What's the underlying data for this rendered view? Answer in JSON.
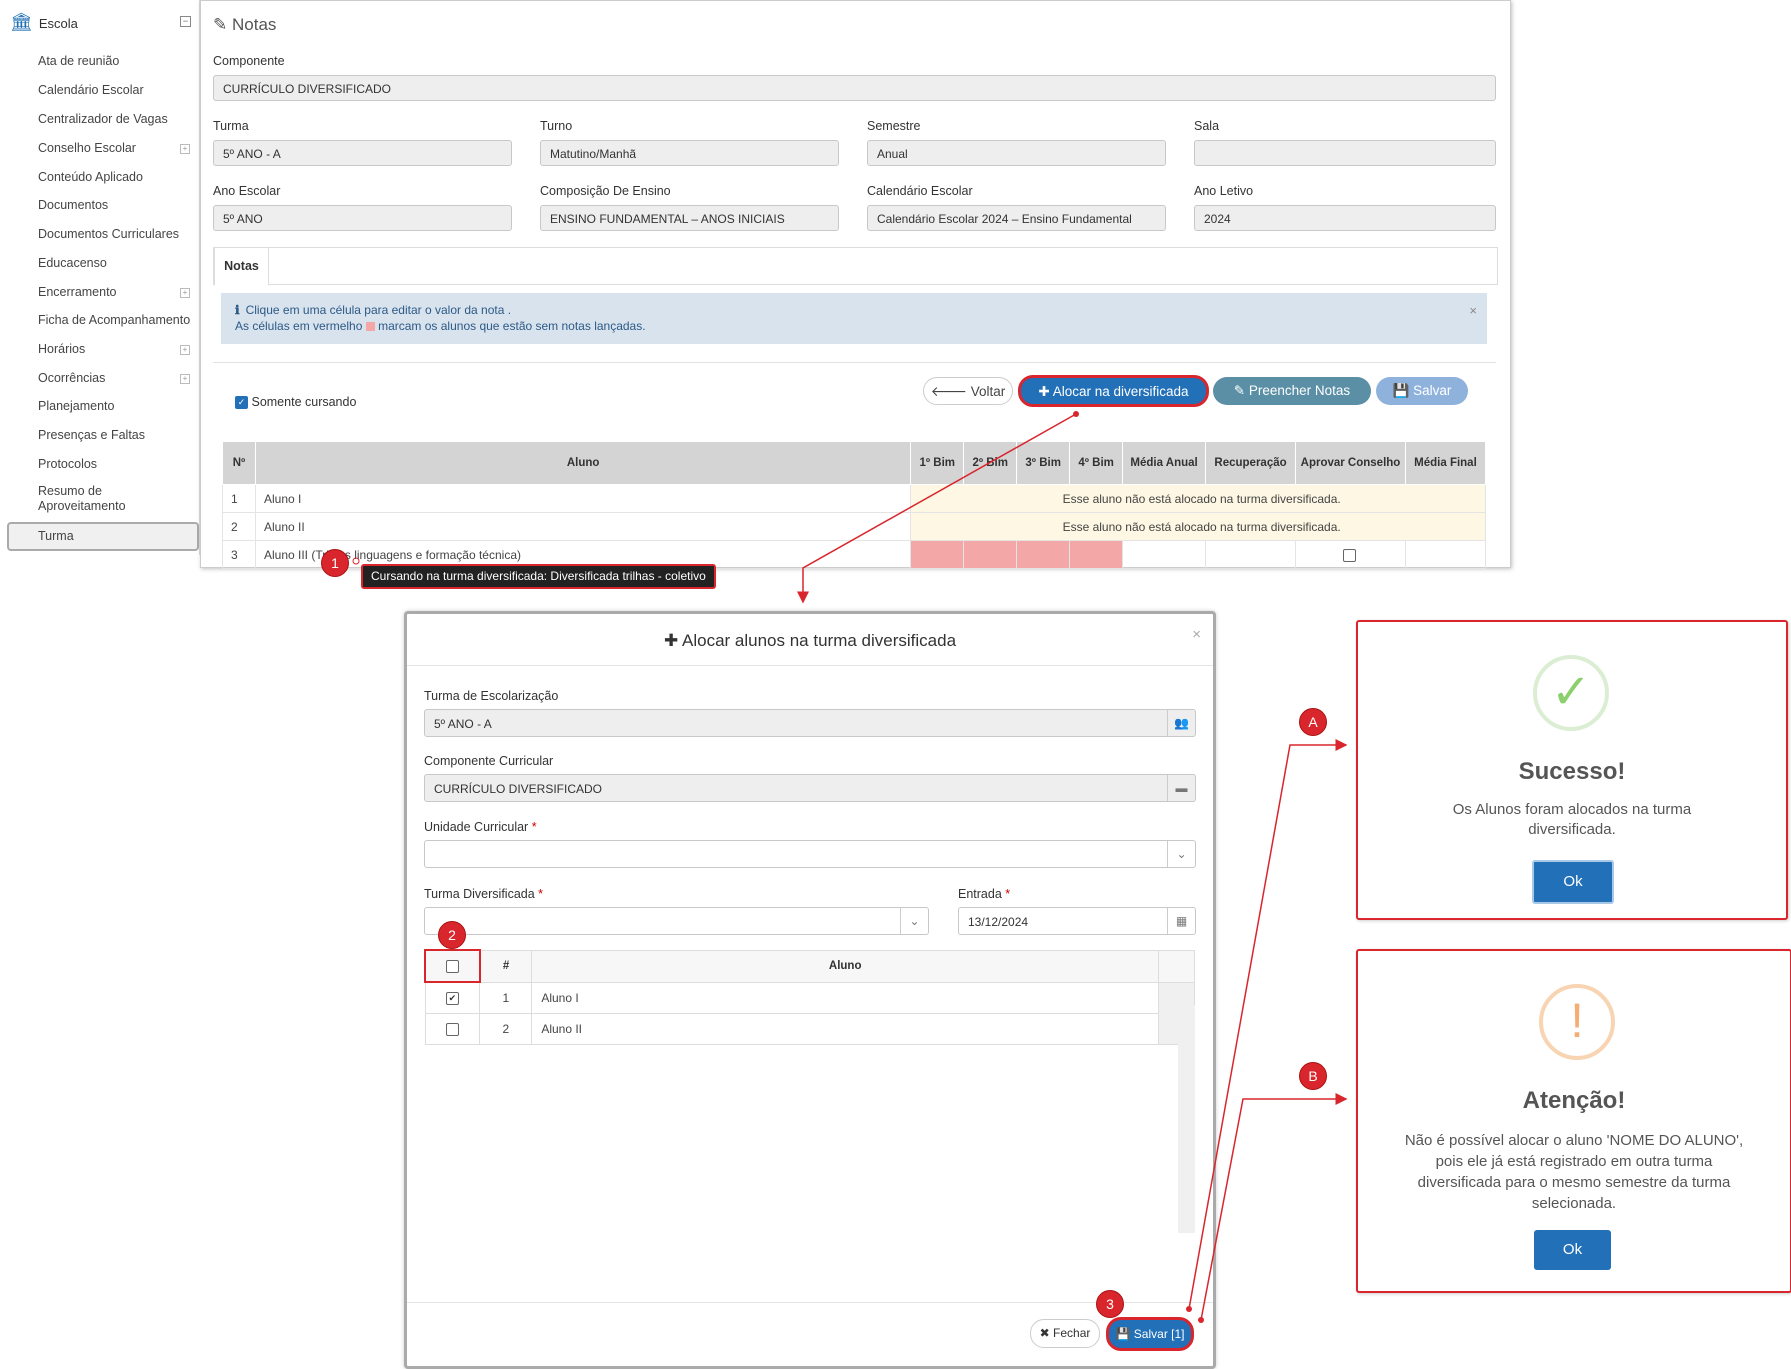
{
  "sidebar": {
    "header": "Escola",
    "items": [
      "Ata de reunião",
      "Calendário Escolar",
      "Centralizador de Vagas",
      "Conselho Escolar",
      "Conteúdo Aplicado",
      "Documentos",
      "Documentos Curriculares",
      "Educacenso",
      "Encerramento",
      "Ficha de Acompanhamento",
      "Horários",
      "Ocorrências",
      "Planejamento",
      "Presenças e Faltas",
      "Protocolos",
      "Resumo de Aproveitamento",
      "Turma"
    ],
    "active": "Turma"
  },
  "page": {
    "title": "Notas",
    "componente_label": "Componente",
    "componente_value": "CURRÍCULO DIVERSIFICADO",
    "turma_label": "Turma",
    "turma_value": "5º ANO - A",
    "turno_label": "Turno",
    "turno_value": "Matutino/Manhã",
    "semestre_label": "Semestre",
    "semestre_value": "Anual",
    "sala_label": "Sala",
    "sala_value": "",
    "ano_escolar_label": "Ano Escolar",
    "ano_escolar_value": "5º ANO",
    "composicao_label": "Composição De Ensino",
    "composicao_value": "ENSINO FUNDAMENTAL – ANOS INICIAIS",
    "calendario_label": "Calendário Escolar",
    "calendario_value": "Calendário Escolar 2024 – Ensino Fundamental",
    "ano_letivo_label": "Ano Letivo",
    "ano_letivo_value": "2024",
    "tab": "Notas",
    "info_line1": "Clique em uma célula para editar o valor da nota .",
    "info_line2a": "As células em vermelho",
    "info_line2b": "marcam os alunos que estão sem notas lançadas.",
    "somente_cursando": "Somente cursando",
    "btn_voltar": "Voltar",
    "btn_alocar": "Alocar na diversificada",
    "btn_preencher": "Preencher Notas",
    "btn_salvar": "Salvar"
  },
  "grades_table": {
    "headers": [
      "Nº",
      "Aluno",
      "1º Bim",
      "2º Bim",
      "3º Bim",
      "4º Bim",
      "Média Anual",
      "Recuperação",
      "Aprovar Conselho",
      "Média Final"
    ],
    "rows": [
      {
        "n": "1",
        "aluno": "Aluno I",
        "note": "Esse aluno não está alocado na turma diversificada."
      },
      {
        "n": "2",
        "aluno": "Aluno II",
        "note": "Esse aluno não está alocado na turma diversificada."
      },
      {
        "n": "3",
        "aluno": "Aluno III (Trilhas linguagens e formação técnica)",
        "note": ""
      }
    ],
    "tooltip": "Cursando na turma diversificada: Diversificada trilhas - coletivo"
  },
  "modal": {
    "title": "Alocar alunos na turma diversificada",
    "turma_escolarizacao_label": "Turma de Escolarização",
    "turma_escolarizacao_value": "5º ANO - A",
    "componente_label": "Componente Curricular",
    "componente_value": "CURRÍCULO DIVERSIFICADO",
    "unidade_label": "Unidade Curricular",
    "turma_div_label": "Turma Diversificada",
    "entrada_label": "Entrada",
    "entrada_value": "13/12/2024",
    "table_headers": [
      "#",
      "Aluno"
    ],
    "rows": [
      {
        "n": "1",
        "aluno": "Aluno I",
        "checked": true
      },
      {
        "n": "2",
        "aluno": "Aluno II",
        "checked": false
      }
    ],
    "btn_fechar": "Fechar",
    "btn_salvar": "Salvar [1]"
  },
  "success": {
    "title": "Sucesso!",
    "message": "Os Alunos foram alocados na turma diversificada.",
    "ok": "Ok"
  },
  "warning": {
    "title": "Atenção!",
    "message": "Não é possível alocar o aluno 'NOME DO ALUNO', pois ele já está registrado em outra turma diversificada para o mesmo semestre da turma selecionada.",
    "ok": "Ok"
  },
  "markers": {
    "m1": "1",
    "m2": "2",
    "m3": "3",
    "mA": "A",
    "mB": "B"
  },
  "colors": {
    "primary": "#2270b8",
    "teal": "#5a8fa6",
    "disabled_blue": "#8fb2dd",
    "highlight": "#d9262d",
    "missing_grade": "#f4a7a7"
  }
}
